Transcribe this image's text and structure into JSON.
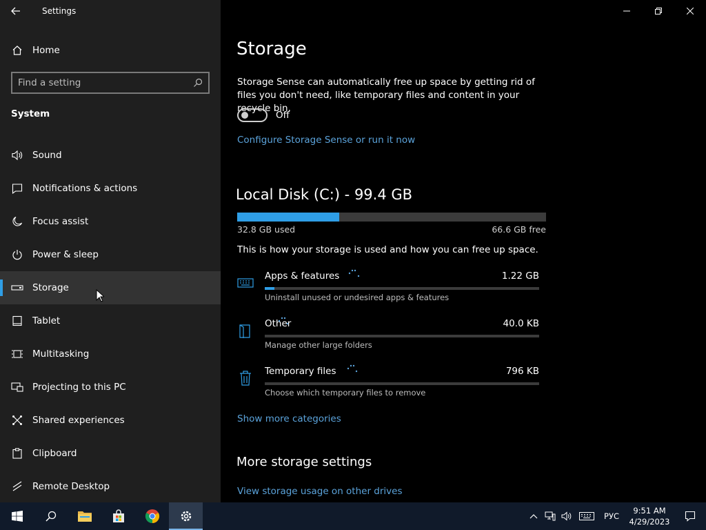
{
  "window": {
    "title": "Settings"
  },
  "sidebar": {
    "home_label": "Home",
    "search_placeholder": "Find a setting",
    "section": "System",
    "items": [
      {
        "label": "Sound",
        "icon": "speaker-icon"
      },
      {
        "label": "Notifications & actions",
        "icon": "notification-icon"
      },
      {
        "label": "Focus assist",
        "icon": "moon-icon"
      },
      {
        "label": "Power & sleep",
        "icon": "power-icon"
      },
      {
        "label": "Storage",
        "icon": "storage-drive-icon",
        "active": true
      },
      {
        "label": "Tablet",
        "icon": "tablet-icon"
      },
      {
        "label": "Multitasking",
        "icon": "multitasking-icon"
      },
      {
        "label": "Projecting to this PC",
        "icon": "projecting-icon"
      },
      {
        "label": "Shared experiences",
        "icon": "shared-experiences-icon"
      },
      {
        "label": "Clipboard",
        "icon": "clipboard-icon"
      },
      {
        "label": "Remote Desktop",
        "icon": "remote-desktop-icon"
      }
    ]
  },
  "main": {
    "title": "Storage",
    "sense_description": "Storage Sense can automatically free up space by getting rid of files you don't need, like temporary files and content in your recycle bin.",
    "toggle_state": "Off",
    "configure_link": "Configure Storage Sense or run it now",
    "disk": {
      "title": "Local Disk (C:) - 99.4 GB",
      "used": "32.8 GB used",
      "free": "66.6 GB free",
      "used_fraction": 0.33
    },
    "usage_description": "This is how your storage is used and how you can free up space.",
    "categories": [
      {
        "name": "Apps & features",
        "size": "1.22 GB",
        "description": "Uninstall unused or undesired apps & features",
        "fraction": 0.035,
        "icon": "keyboard-icon"
      },
      {
        "name": "Other",
        "size": "40.0 KB",
        "description": "Manage other large folders",
        "fraction": 0.0,
        "icon": "folder-icon"
      },
      {
        "name": "Temporary files",
        "size": "796 KB",
        "description": "Choose which temporary files to remove",
        "fraction": 0.0,
        "icon": "trash-icon"
      }
    ],
    "show_more": "Show more categories",
    "more_title": "More storage settings",
    "other_drives_link": "View storage usage on other drives"
  },
  "taskbar": {
    "language": "РУС",
    "time": "9:51 AM",
    "date": "4/29/2023"
  },
  "colors": {
    "accent": "#2f9ee6",
    "link": "#5ba3db",
    "sidebar_bg": "#1f1f1f",
    "taskbar_bg": "#101a2a"
  }
}
